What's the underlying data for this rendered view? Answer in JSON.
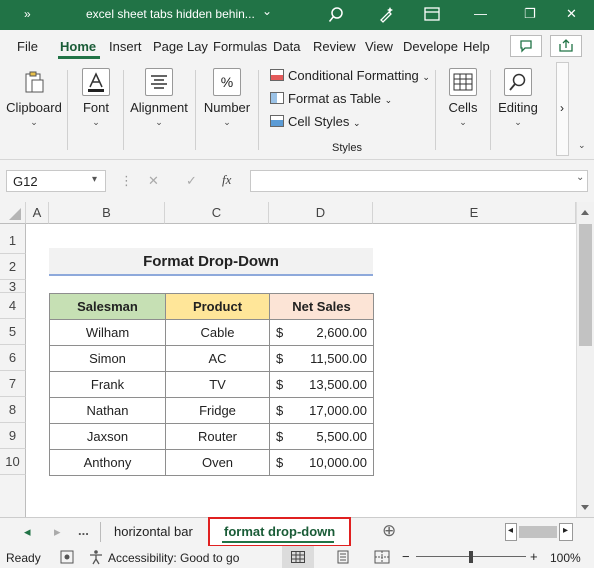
{
  "title_bar": {
    "overflow_glyph": "»",
    "doc_title": "excel sheet tabs hidden behin...",
    "title_dropdown": "⌄",
    "search_icon": "search-icon",
    "pen_icon": "magic-pen-icon",
    "minimize": "—",
    "restore": "❐",
    "close": "✕",
    "bg_color": "#217346"
  },
  "menu": {
    "items": [
      "File",
      "Home",
      "Insert",
      "Page Lay",
      "Formulas",
      "Data",
      "Review",
      "View",
      "Develope",
      "Help"
    ],
    "active": "Home",
    "accent_color": "#217346"
  },
  "ribbon": {
    "clipboard": "Clipboard",
    "font": "Font",
    "alignment": "Alignment",
    "number": "Number",
    "number_glyph": "%",
    "conditional_formatting": "Conditional Formatting",
    "format_as_table": "Format as Table",
    "cell_styles": "Cell Styles",
    "styles_group": "Styles",
    "cells": "Cells",
    "editing": "Editing",
    "chevron": "⌄",
    "scroll_right": "›"
  },
  "formula_bar": {
    "name_box": "G12",
    "name_box_arrow": "▾",
    "more": "⋮",
    "cancel": "✕",
    "enter": "✓",
    "fx": "fx",
    "formula_value": "",
    "expand": "⌄"
  },
  "columns": [
    "A",
    "B",
    "C",
    "D",
    "E"
  ],
  "rows": [
    "1",
    "2",
    "3",
    "4",
    "5",
    "6",
    "7",
    "8",
    "9",
    "10"
  ],
  "sheet": {
    "heading": "Format Drop-Down",
    "headers": [
      "Salesman",
      "Product",
      "Net Sales"
    ],
    "header_colors": [
      "#c6e0b4",
      "#ffe699",
      "#fce4d6"
    ],
    "currency": "$",
    "data": [
      {
        "salesman": "Wilham",
        "product": "Cable",
        "net_sales": "2,600.00"
      },
      {
        "salesman": "Simon",
        "product": "AC",
        "net_sales": "11,500.00"
      },
      {
        "salesman": "Frank",
        "product": "TV",
        "net_sales": "13,500.00"
      },
      {
        "salesman": "Nathan",
        "product": "Fridge",
        "net_sales": "17,000.00"
      },
      {
        "salesman": "Jaxson",
        "product": "Router",
        "net_sales": "5,500.00"
      },
      {
        "salesman": "Anthony",
        "product": "Oven",
        "net_sales": "10,000.00"
      }
    ]
  },
  "tabs": {
    "prev": "◂",
    "next": "▸",
    "ellipsis": "...",
    "items": [
      "horizontal bar",
      "format drop-down"
    ],
    "active_index": 1,
    "add": "⊕",
    "highlight_color": "#e02020"
  },
  "status": {
    "ready": "Ready",
    "accessibility": "Accessibility: Good to go",
    "zoom_minus": "−",
    "zoom_plus": "+",
    "zoom": "100%",
    "zoom_level_pct": 100
  }
}
